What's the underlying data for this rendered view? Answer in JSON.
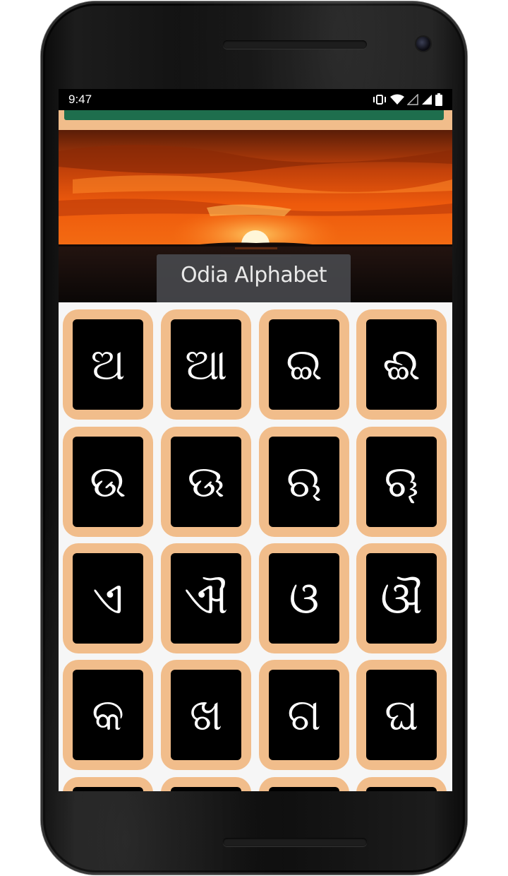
{
  "status_bar": {
    "time": "9:47",
    "icons": [
      "vibrate-icon",
      "wifi-icon",
      "signal-empty-icon",
      "signal-icon",
      "battery-icon"
    ]
  },
  "app": {
    "accent_color": "#1e6e4d",
    "tile_color": "#f1bd8b",
    "hero_title": "Odia Alphabet"
  },
  "letters": [
    "ଅ",
    "ଆ",
    "ଇ",
    "ଈ",
    "ଉ",
    "ଊ",
    "ଋ",
    "ୠ",
    "ଏ",
    "ଐ",
    "ଓ",
    "ଔ",
    "କ",
    "ଖ",
    "ଗ",
    "ଘ",
    "",
    "",
    "",
    ""
  ]
}
